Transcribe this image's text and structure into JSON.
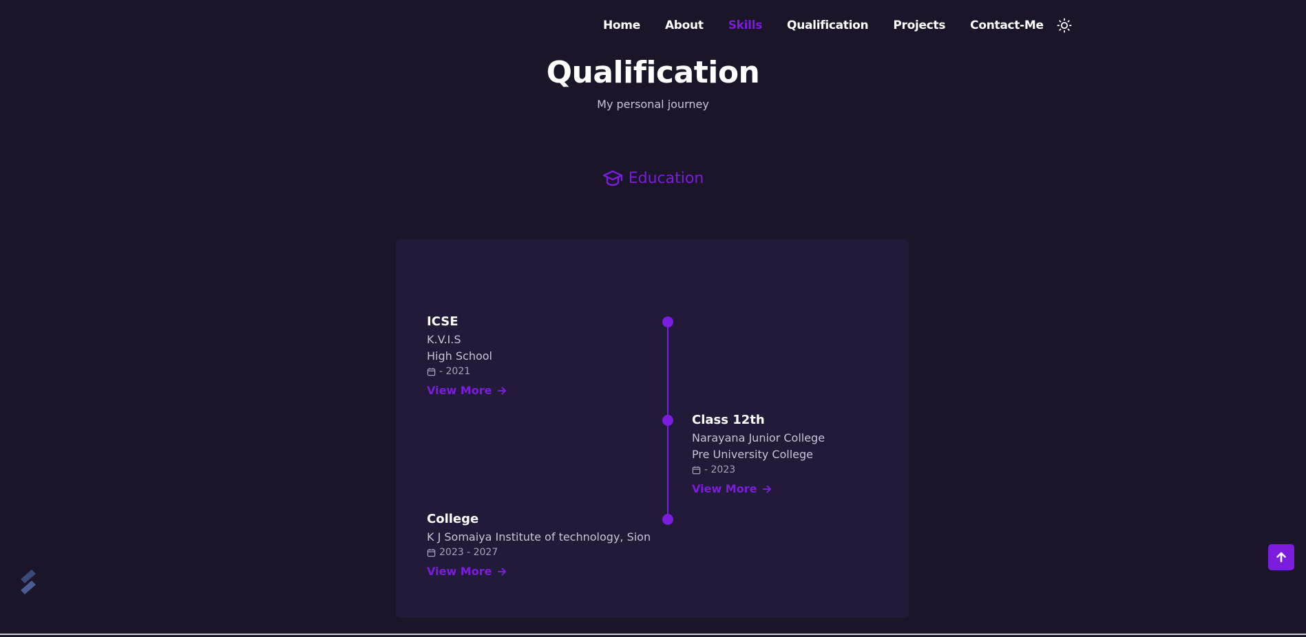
{
  "nav": {
    "items": [
      {
        "label": "Home"
      },
      {
        "label": "About"
      },
      {
        "label": "Skills"
      },
      {
        "label": "Qualification"
      },
      {
        "label": "Projects"
      },
      {
        "label": "Contact-Me"
      }
    ],
    "active_label": "Skills",
    "theme_icon": "sun-icon"
  },
  "header": {
    "title": "Qualification",
    "subtitle": "My personal journey"
  },
  "tab": {
    "label": "Education",
    "icon": "graduation-cap-icon"
  },
  "timeline": {
    "entries": [
      {
        "title": "ICSE",
        "lines": [
          "K.V.I.S",
          "High School"
        ],
        "date": "- 2021",
        "link": "View More"
      },
      {
        "title": "Class 12th",
        "lines": [
          "Narayana Junior College",
          "Pre University College"
        ],
        "date": "- 2023",
        "link": "View More"
      },
      {
        "title": "College",
        "lines": [
          "K J Somaiya Institute of technology, Sion"
        ],
        "date": "2023 - 2027",
        "link": "View More"
      }
    ]
  },
  "colors": {
    "background": "#1a1528",
    "card": "#221a39",
    "accent": "#7c1ddd",
    "text": "#ffffff",
    "muted": "#c9c4d8"
  },
  "floating": {
    "scroll_up_icon": "arrow-up-icon",
    "brand_icon": "brand-logo-icon"
  }
}
